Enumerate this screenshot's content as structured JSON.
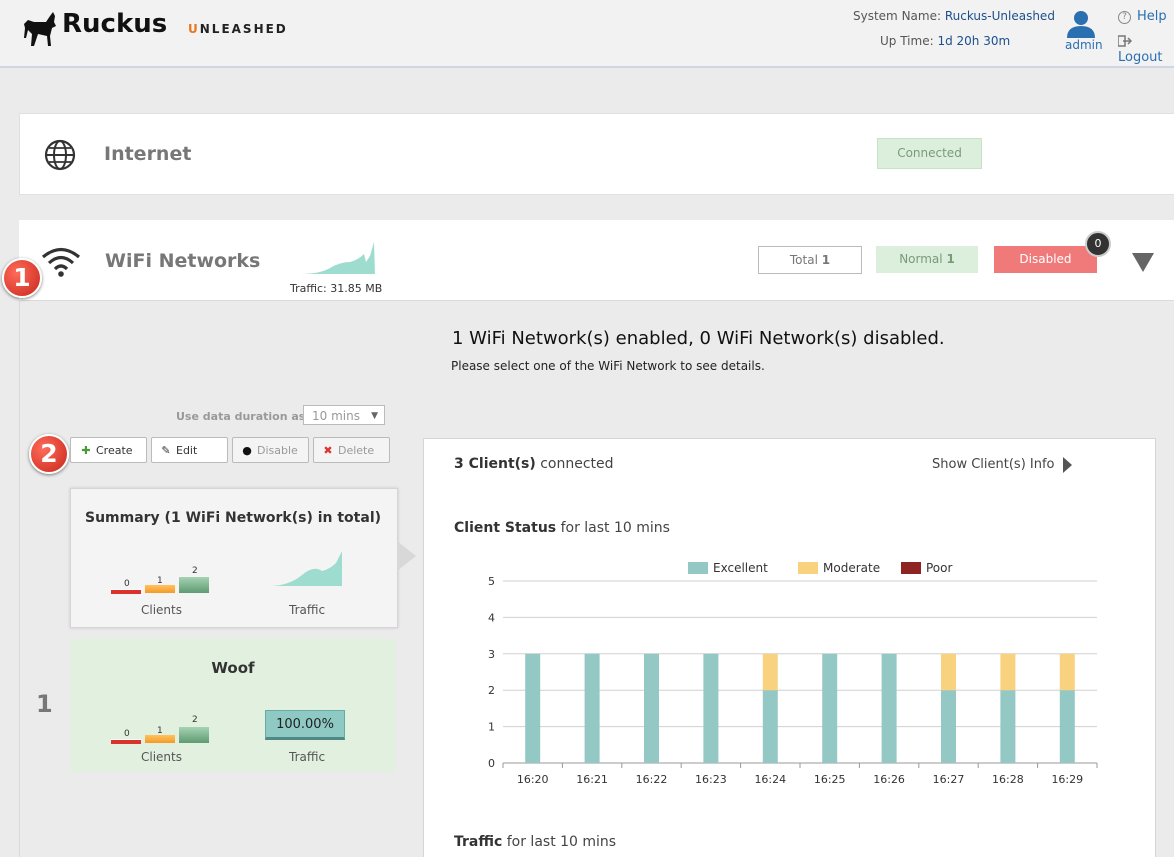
{
  "header": {
    "brand": "Ruckus",
    "product": "UNLEASHED",
    "system_name_label": "System Name:",
    "system_name": "Ruckus-Unleashed",
    "uptime_label": "Up Time:",
    "uptime": "1d 20h 30m",
    "user": "admin",
    "help": "Help",
    "logout": "Logout"
  },
  "internet": {
    "title": "Internet",
    "status": "Connected"
  },
  "wifi": {
    "title": "WiFi Networks",
    "traffic": "Traffic: 31.85 MB",
    "total_label": "Total",
    "total": "1",
    "normal_label": "Normal",
    "normal": "1",
    "disabled_label": "Disabled",
    "disabled_badge": "0",
    "step1": "1",
    "step2": "2",
    "heading": "1 WiFi Network(s) enabled, 0 WiFi Network(s) disabled.",
    "subheading": "Please select one of the WiFi Network to see details.",
    "duration_label": "Use data duration as :",
    "duration_value": "10 mins",
    "buttons": {
      "create": "Create",
      "edit": "Edit",
      "disable": "Disable",
      "delete": "Delete"
    },
    "summary": {
      "title": "Summary (1 WiFi Network(s) in total)",
      "clients_label": "Clients",
      "traffic_label": "Traffic",
      "client_counts": [
        "0",
        "1",
        "2"
      ]
    },
    "networks": [
      {
        "index": "1",
        "name": "Woof",
        "clients_label": "Clients",
        "traffic_label": "Traffic",
        "client_counts": [
          "0",
          "1",
          "2"
        ],
        "traffic_pct": "100.00%"
      }
    ]
  },
  "details": {
    "clients_count": "3 Client(s)",
    "clients_suffix": " connected",
    "show_client_info": "Show Client(s) Info",
    "client_status_title": "Client Status",
    "client_status_suffix": " for last 10 mins",
    "traffic_title": "Traffic",
    "traffic_suffix": " for last 10 mins"
  },
  "colors": {
    "excellent": "#93c8c4",
    "moderate": "#f8d27f",
    "poor": "#8e2323"
  },
  "chart_data": {
    "type": "bar",
    "stacked": true,
    "categories": [
      "16:20",
      "16:21",
      "16:22",
      "16:23",
      "16:24",
      "16:25",
      "16:26",
      "16:27",
      "16:28",
      "16:29"
    ],
    "series": [
      {
        "name": "Excellent",
        "values": [
          3,
          3,
          3,
          3,
          2,
          3,
          3,
          2,
          2,
          2
        ]
      },
      {
        "name": "Moderate",
        "values": [
          0,
          0,
          0,
          0,
          1,
          0,
          0,
          1,
          1,
          1
        ]
      },
      {
        "name": "Poor",
        "values": [
          0,
          0,
          0,
          0,
          0,
          0,
          0,
          0,
          0,
          0
        ]
      }
    ],
    "ylim": [
      0,
      5
    ],
    "yticks": [
      "0",
      "1",
      "2",
      "3",
      "4",
      "5"
    ],
    "grid": true,
    "legend": "top-center"
  }
}
